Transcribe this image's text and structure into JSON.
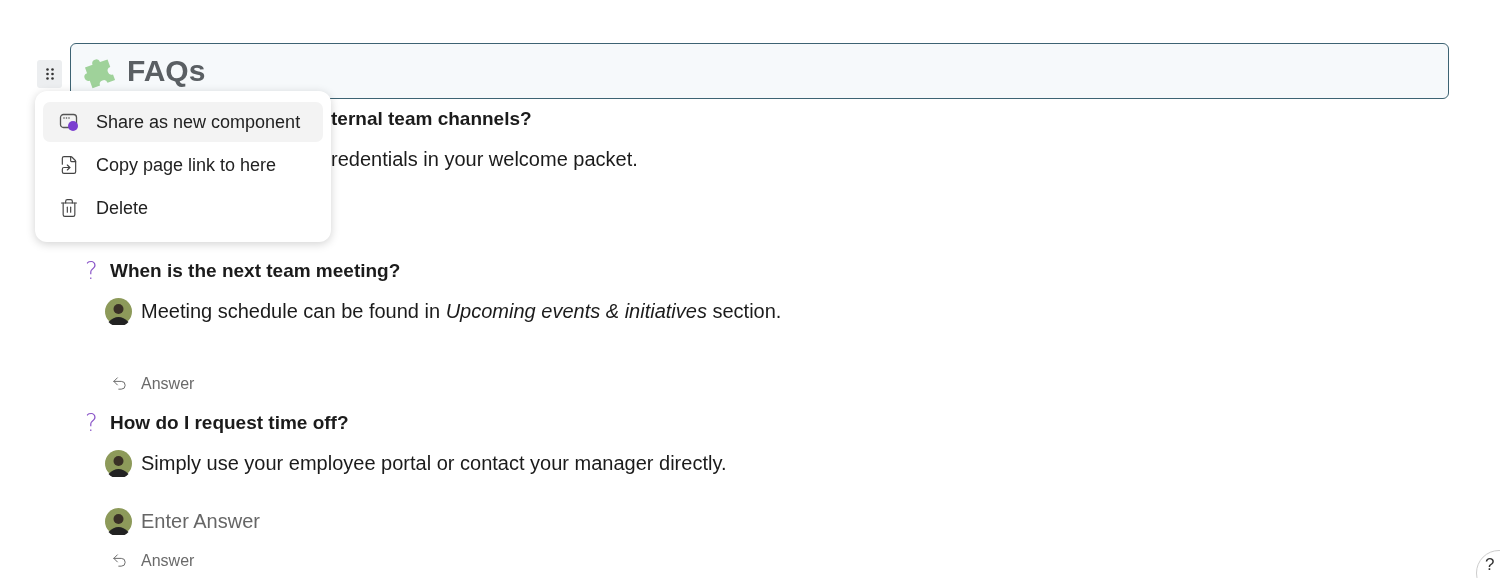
{
  "block_title": "FAQs",
  "context_menu": {
    "items": [
      {
        "label": "Share as new component",
        "kind": "share",
        "selected": true
      },
      {
        "label": "Copy page link to here",
        "kind": "link",
        "selected": false
      },
      {
        "label": "Delete",
        "kind": "trash",
        "selected": false
      }
    ]
  },
  "faqs": [
    {
      "kind": "clipped",
      "question": "ternal team channels?",
      "answer": "redentials in your welcome packet."
    },
    {
      "kind": "full",
      "mark": "?",
      "question": "When is the next team meeting?",
      "answer": "Meeting schedule can be found in *Upcoming events & initiatives* section.",
      "reply_label": "Answer"
    },
    {
      "kind": "full",
      "mark": "?",
      "question": "How do I request time off?",
      "answer": "Simply use your employee portal or contact your manager directly.",
      "answer_placeholder": "Enter Answer",
      "reply_label": "Answer"
    }
  ],
  "help_button": "?"
}
